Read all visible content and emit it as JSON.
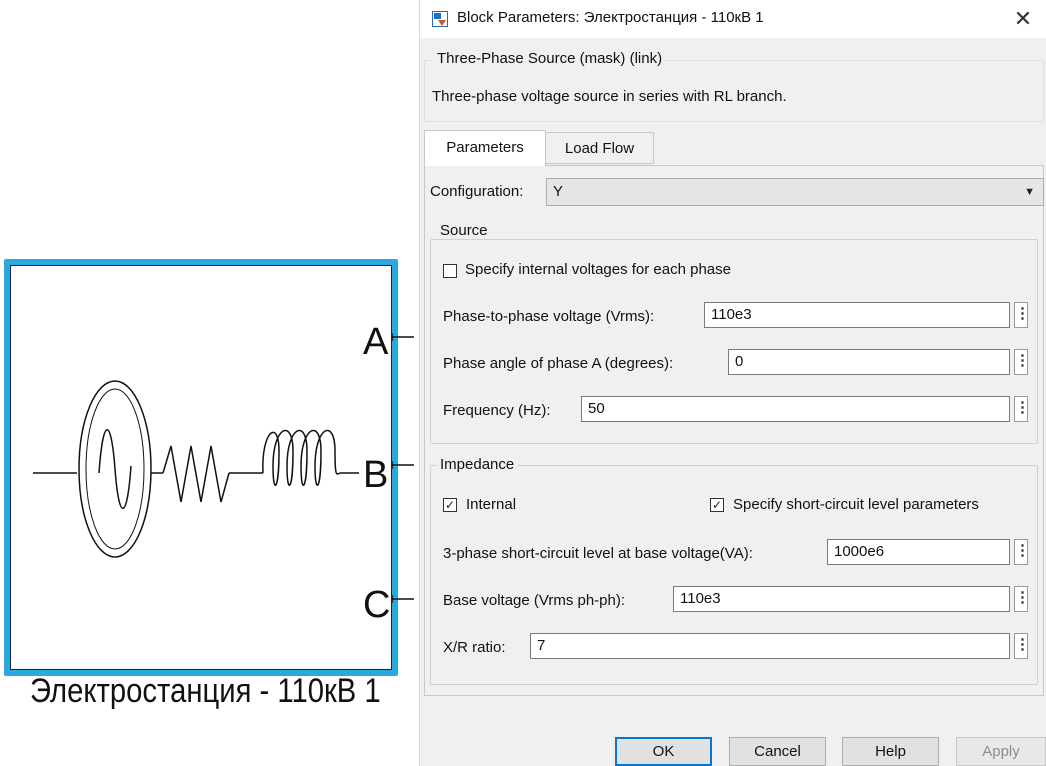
{
  "block": {
    "port_a": "A",
    "port_b": "B",
    "port_c": "C",
    "caption": "Электростанция - 110кВ 1",
    "accent_color": "#2aa9e0"
  },
  "dialog": {
    "title": "Block Parameters: Электростанция - 110кВ 1",
    "close_glyph": "✕",
    "mask_legend": "Three-Phase Source (mask) (link)",
    "description": "Three-phase voltage source in series with RL branch.",
    "tabs": [
      {
        "label": "Parameters",
        "active": true
      },
      {
        "label": "Load Flow",
        "active": false
      }
    ],
    "configuration": {
      "label": "Configuration:",
      "value": "Y",
      "caret": "▼"
    },
    "source": {
      "legend": "Source",
      "specify_internal": {
        "label": "Specify internal voltages for each phase",
        "checked": false,
        "glyph": ""
      },
      "phase_voltage": {
        "label": "Phase-to-phase voltage (Vrms):",
        "value": "110e3"
      },
      "phase_angle": {
        "label": "Phase angle of phase A (degrees):",
        "value": "0"
      },
      "frequency": {
        "label": "Frequency (Hz):",
        "value": "50"
      }
    },
    "impedance": {
      "legend": "Impedance",
      "internal": {
        "label": "Internal",
        "checked": true,
        "glyph": "✓"
      },
      "short_circuit_params": {
        "label": "Specify short-circuit level parameters",
        "checked": true,
        "glyph": "✓"
      },
      "sc_level": {
        "label": "3-phase short-circuit level at base voltage(VA):",
        "value": "1000e6"
      },
      "base_voltage": {
        "label": "Base voltage (Vrms ph-ph):",
        "value": "110e3"
      },
      "xr_ratio": {
        "label": "X/R ratio:",
        "value": "7"
      }
    },
    "kebab_glyph": "⋮",
    "buttons": {
      "ok": "OK",
      "cancel": "Cancel",
      "help": "Help",
      "apply": "Apply"
    }
  }
}
